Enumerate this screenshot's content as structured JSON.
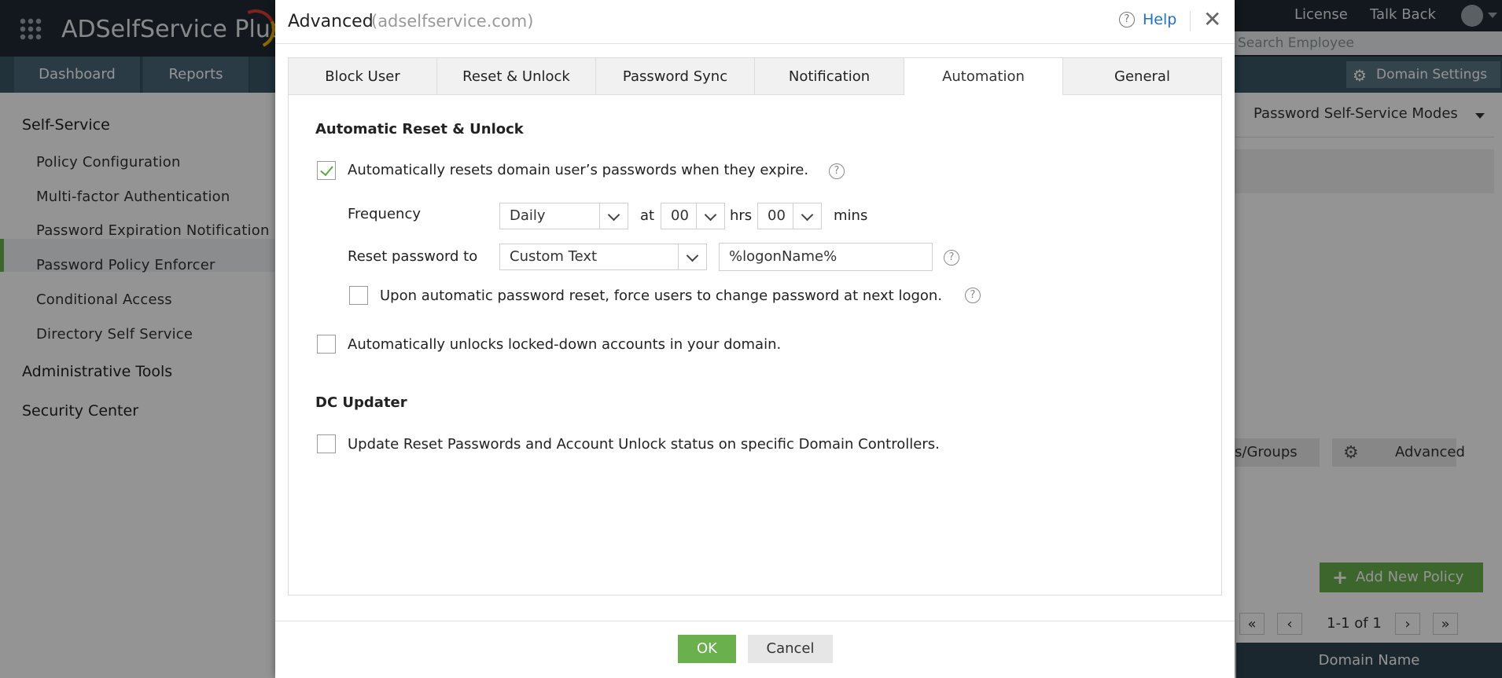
{
  "app": {
    "brand": "ADSelfService Plus",
    "top_links": {
      "license": "License",
      "talk_back": "Talk Back"
    },
    "search_placeholder": "Search Employee",
    "nav": [
      "Dashboard",
      "Reports"
    ],
    "domain_settings": "Domain Settings",
    "sidebar": {
      "self_service": "Self-Service",
      "items": [
        "Policy Configuration",
        "Multi-factor Authentication",
        "Password Expiration Notification",
        "Password Policy Enforcer",
        "Conditional Access",
        "Directory Self Service"
      ],
      "admin_tools": "Administrative Tools",
      "security_center": "Security Center"
    },
    "right_panel": {
      "modes": "Password Self-Service Modes",
      "groups_btn": "s/Groups",
      "advanced_btn": "Advanced",
      "add_policy": "Add New Policy",
      "pager_text": "1-1 of 1",
      "domain_name_header": "Domain Name"
    }
  },
  "dialog": {
    "title": "Advanced",
    "subtitle": "(adselfservice.com)",
    "help": "Help",
    "tabs": [
      "Block User",
      "Reset & Unlock",
      "Password Sync",
      "Notification",
      "Automation",
      "General"
    ],
    "active_tab": "Automation",
    "section1": {
      "title": "Automatic Reset & Unlock",
      "auto_reset_label": "Automatically resets domain user’s passwords when they expire.",
      "auto_reset_checked": true,
      "frequency_label": "Frequency",
      "frequency_value": "Daily",
      "at_label": "at",
      "hours_value": "00",
      "hrs_label": "hrs",
      "mins_value": "00",
      "mins_label": "mins",
      "reset_to_label": "Reset password to",
      "reset_to_value": "Custom Text",
      "custom_text_value": "%logonName%",
      "force_change_label": "Upon automatic password reset, force users to change password at next logon.",
      "force_change_checked": false,
      "auto_unlock_label": "Automatically unlocks locked-down accounts in your domain.",
      "auto_unlock_checked": false
    },
    "section2": {
      "title": "DC Updater",
      "dc_update_label": "Update Reset Passwords and Account Unlock status on specific Domain Controllers.",
      "dc_update_checked": false
    },
    "ok": "OK",
    "cancel": "Cancel"
  }
}
